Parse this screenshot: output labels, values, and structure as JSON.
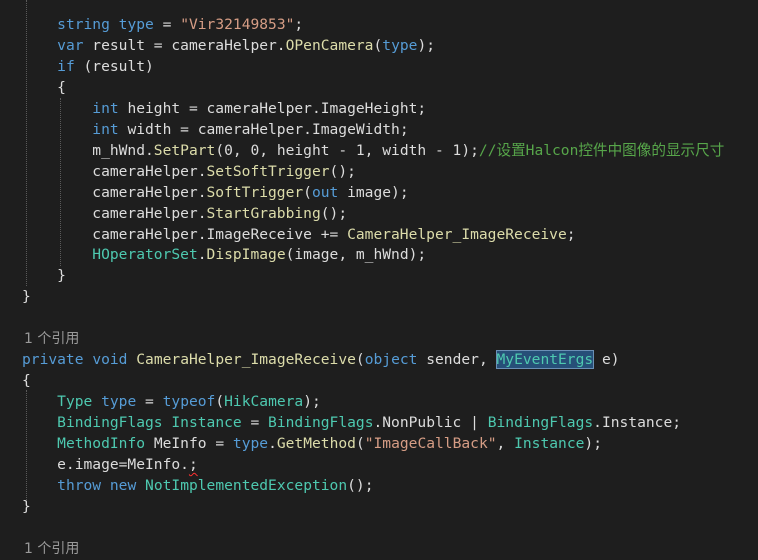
{
  "code": {
    "lines": [
      [
        {
          "t": "    "
        },
        {
          "t": "string",
          "c": "k"
        },
        {
          "t": " "
        },
        {
          "t": "type",
          "c": "k"
        },
        {
          "t": " = "
        },
        {
          "t": "\"Vir32149853\"",
          "c": "s"
        },
        {
          "t": ";"
        }
      ],
      [
        {
          "t": "    "
        },
        {
          "t": "var",
          "c": "k"
        },
        {
          "t": " result = cameraHelper."
        },
        {
          "t": "OPenCamera",
          "c": "m"
        },
        {
          "t": "("
        },
        {
          "t": "type",
          "c": "k"
        },
        {
          "t": ");"
        }
      ],
      [
        {
          "t": "    "
        },
        {
          "t": "if",
          "c": "k"
        },
        {
          "t": " (result)"
        }
      ],
      [
        {
          "t": "    {"
        }
      ],
      [
        {
          "t": "        "
        },
        {
          "t": "int",
          "c": "k"
        },
        {
          "t": " height = cameraHelper.ImageHeight;"
        }
      ],
      [
        {
          "t": "        "
        },
        {
          "t": "int",
          "c": "k"
        },
        {
          "t": " width = cameraHelper.ImageWidth;"
        }
      ],
      [
        {
          "t": "        m_hWnd."
        },
        {
          "t": "SetPart",
          "c": "m"
        },
        {
          "t": "(0, 0, height - 1, width - 1);"
        },
        {
          "t": "//设置Halcon控件中图像的显示尺寸",
          "c": "c"
        }
      ],
      [
        {
          "t": "        cameraHelper."
        },
        {
          "t": "SetSoftTrigger",
          "c": "m"
        },
        {
          "t": "();"
        }
      ],
      [
        {
          "t": "        cameraHelper."
        },
        {
          "t": "SoftTrigger",
          "c": "m"
        },
        {
          "t": "("
        },
        {
          "t": "out",
          "c": "k"
        },
        {
          "t": " image);"
        }
      ],
      [
        {
          "t": "        cameraHelper."
        },
        {
          "t": "StartGrabbing",
          "c": "m"
        },
        {
          "t": "();"
        }
      ],
      [
        {
          "t": "        cameraHelper.ImageReceive += "
        },
        {
          "t": "CameraHelper_ImageReceive",
          "c": "m"
        },
        {
          "t": ";"
        }
      ],
      [
        {
          "t": "        "
        },
        {
          "t": "HOperatorSet",
          "c": "t"
        },
        {
          "t": "."
        },
        {
          "t": "DispImage",
          "c": "m"
        },
        {
          "t": "(image, m_hWnd);"
        }
      ],
      [
        {
          "t": "    }"
        }
      ],
      [
        {
          "t": "}"
        }
      ],
      [],
      [
        {
          "t": "1 个引用",
          "c": "lens"
        }
      ],
      [
        {
          "t": "private",
          "c": "k"
        },
        {
          "t": " "
        },
        {
          "t": "void",
          "c": "k"
        },
        {
          "t": " "
        },
        {
          "t": "CameraHelper_ImageReceive",
          "c": "m"
        },
        {
          "t": "("
        },
        {
          "t": "object",
          "c": "k"
        },
        {
          "t": " sender, "
        },
        {
          "t": "MyEventErgs",
          "c": "hl"
        },
        {
          "t": " e)"
        }
      ],
      [
        {
          "t": "{"
        }
      ],
      [
        {
          "t": "    "
        },
        {
          "t": "Type",
          "c": "t"
        },
        {
          "t": " "
        },
        {
          "t": "type",
          "c": "k"
        },
        {
          "t": " = "
        },
        {
          "t": "typeof",
          "c": "k"
        },
        {
          "t": "("
        },
        {
          "t": "HikCamera",
          "c": "t"
        },
        {
          "t": ");"
        }
      ],
      [
        {
          "t": "    "
        },
        {
          "t": "BindingFlags",
          "c": "t"
        },
        {
          "t": " "
        },
        {
          "t": "Instance",
          "c": "t"
        },
        {
          "t": " = "
        },
        {
          "t": "BindingFlags",
          "c": "t"
        },
        {
          "t": ".NonPublic | "
        },
        {
          "t": "BindingFlags",
          "c": "t"
        },
        {
          "t": ".Instance;"
        }
      ],
      [
        {
          "t": "    "
        },
        {
          "t": "MethodInfo",
          "c": "t"
        },
        {
          "t": " MeInfo = "
        },
        {
          "t": "type",
          "c": "k"
        },
        {
          "t": "."
        },
        {
          "t": "GetMethod",
          "c": "m"
        },
        {
          "t": "("
        },
        {
          "t": "\"ImageCallBack\"",
          "c": "s"
        },
        {
          "t": ", "
        },
        {
          "t": "Instance",
          "c": "t"
        },
        {
          "t": ");"
        }
      ],
      [
        {
          "t": "    e.image=MeInfo."
        },
        {
          "t": ";",
          "c": "sq"
        }
      ],
      [
        {
          "t": "    "
        },
        {
          "t": "throw",
          "c": "k"
        },
        {
          "t": " "
        },
        {
          "t": "new",
          "c": "k"
        },
        {
          "t": " "
        },
        {
          "t": "NotImplementedException",
          "c": "t"
        },
        {
          "t": "();"
        }
      ],
      [
        {
          "t": "}"
        }
      ],
      [],
      [
        {
          "t": "1 个引用",
          "c": "lens"
        }
      ]
    ]
  },
  "colors": {
    "background": "#1e1e1e",
    "keyword": "#569cd6",
    "type": "#4ec9b0",
    "string": "#d69d85",
    "comment": "#57a64a",
    "method": "#dcdcaa",
    "plain": "#dcdcdc",
    "codelens": "#999999",
    "highlight": "#264f78"
  }
}
